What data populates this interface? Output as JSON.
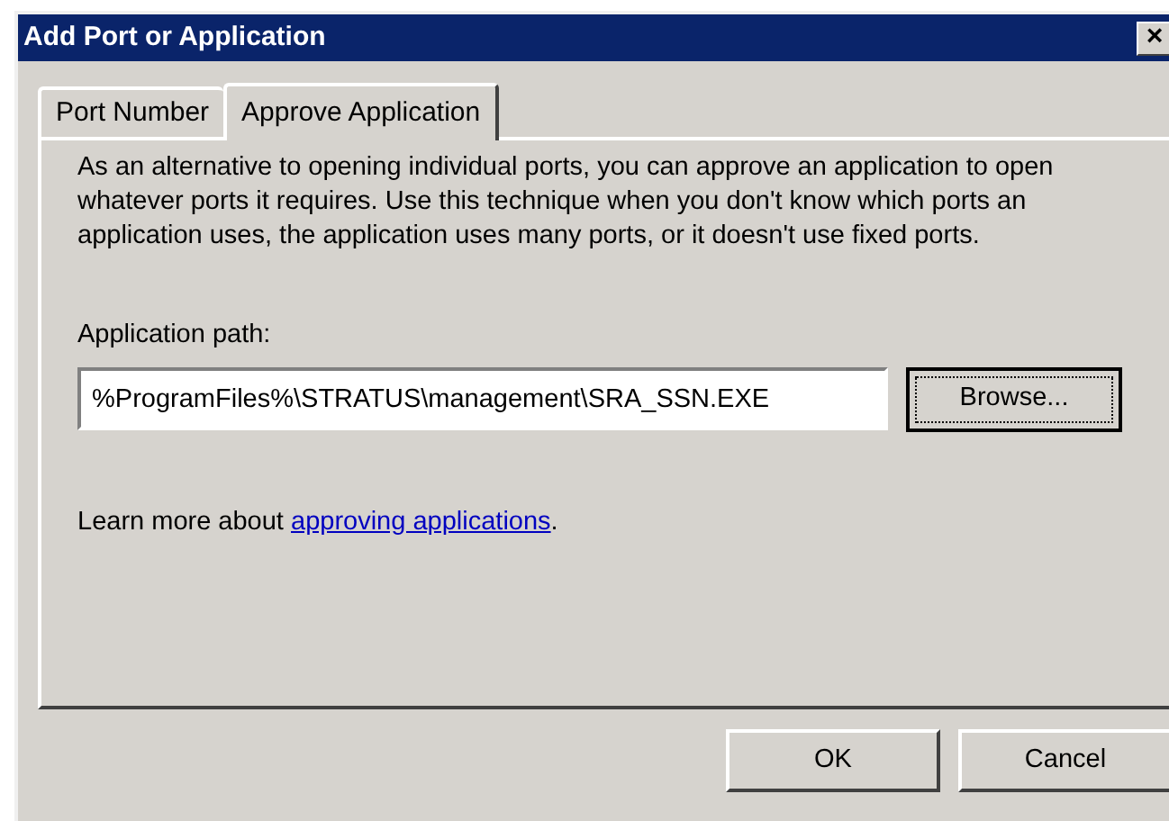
{
  "window": {
    "title": "Add Port or Application",
    "close_label": "×"
  },
  "tabs": [
    {
      "label": "Port Number",
      "selected": false
    },
    {
      "label": "Approve Application",
      "selected": true
    }
  ],
  "description": "As an alternative to opening individual ports, you can approve an application to open whatever ports it requires. Use this technique when you don't know which ports an application uses, the application uses many ports, or it doesn't use fixed ports.",
  "path_field": {
    "label": "Application path:",
    "value": "%ProgramFiles%\\STRATUS\\management\\SRA_SSN.EXE"
  },
  "browse_button": "Browse...",
  "learn_more": {
    "text": "Learn more about ",
    "link": "approving applications",
    "suffix": "."
  },
  "buttons": [
    "OK",
    "Cancel"
  ]
}
